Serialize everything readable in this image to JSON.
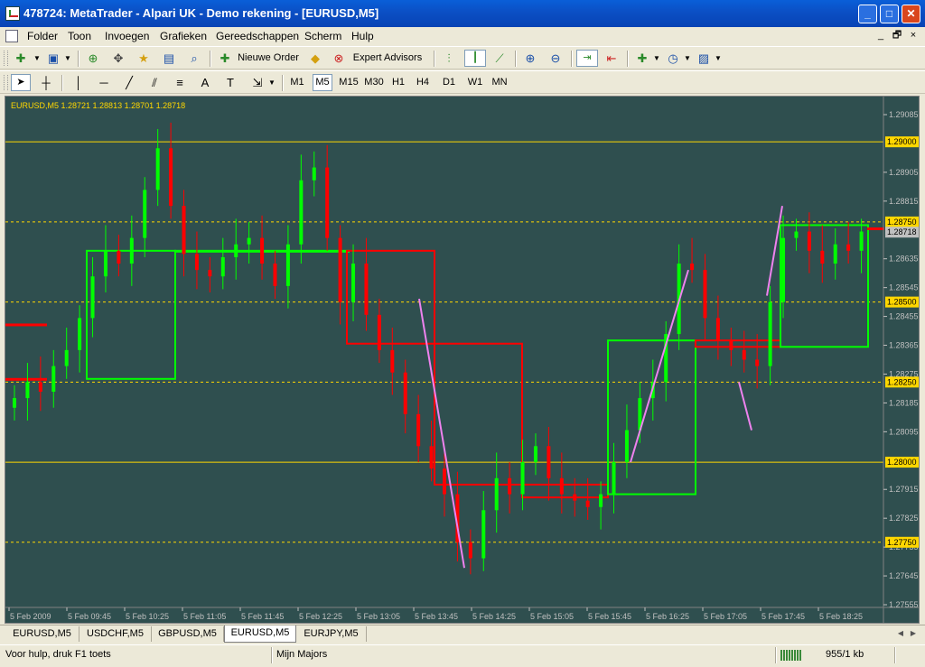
{
  "window": {
    "title": "478724: MetaTrader - Alpari UK - Demo rekening - [EURUSD,M5]",
    "controls": [
      "_",
      "□",
      "✕"
    ]
  },
  "menu": {
    "items": [
      "Folder",
      "Toon",
      "Invoegen",
      "Grafieken",
      "Gereedschappen",
      "Scherm",
      "Hulp"
    ],
    "mdi_controls": [
      "_",
      "🗗",
      "×"
    ]
  },
  "toolbar1": {
    "new_order_label": "Nieuwe Order",
    "expert_advisors_label": "Expert Advisors"
  },
  "toolbar2": {
    "timeframes": [
      "M1",
      "M5",
      "M15",
      "M30",
      "H1",
      "H4",
      "D1",
      "W1",
      "MN"
    ],
    "active_timeframe": "M5",
    "text_tool": "A"
  },
  "chart": {
    "info": "EURUSD,M5  1.28721 1.28813 1.28701 1.28718",
    "background": "#2f4f4f",
    "bull_color": "#00ff00",
    "bear_color": "#ff0000",
    "level_color": "#ffd700",
    "price_axis": [
      "1.29085",
      "1.28905",
      "1.28815",
      "1.28635",
      "1.28545",
      "1.28455",
      "1.28365",
      "1.28275",
      "1.28185",
      "1.28095",
      "1.27915",
      "1.27825",
      "1.27735",
      "1.27645",
      "1.27555"
    ],
    "level_labels": [
      {
        "price": 1.29,
        "text": "1.29000",
        "dashed": false
      },
      {
        "price": 1.2875,
        "text": "1.28750",
        "dashed": true
      },
      {
        "price": 1.285,
        "text": "1.28500",
        "dashed": true
      },
      {
        "price": 1.2825,
        "text": "1.28250",
        "dashed": true
      },
      {
        "price": 1.28,
        "text": "1.28000",
        "dashed": false
      },
      {
        "price": 1.2775,
        "text": "1.27750",
        "dashed": true
      }
    ],
    "current_price": "1.28718",
    "time_axis": [
      "5 Feb 2009",
      "5 Feb 09:45",
      "5 Feb 10:25",
      "5 Feb 11:05",
      "5 Feb 11:45",
      "5 Feb 12:25",
      "5 Feb 13:05",
      "5 Feb 13:45",
      "5 Feb 14:25",
      "5 Feb 15:05",
      "5 Feb 15:45",
      "5 Feb 16:25",
      "5 Feb 17:05",
      "5 Feb 17:45",
      "5 Feb 18:25"
    ]
  },
  "tabs": {
    "items": [
      "EURUSD,M5",
      "USDCHF,M5",
      "GBPUSD,M5",
      "EURUSD,M5",
      "EURJPY,M5"
    ],
    "active_index": 3
  },
  "status": {
    "help": "Voor hulp, druk F1 toets",
    "profile": "Mijn Majors",
    "traffic": "955/1 kb"
  }
}
